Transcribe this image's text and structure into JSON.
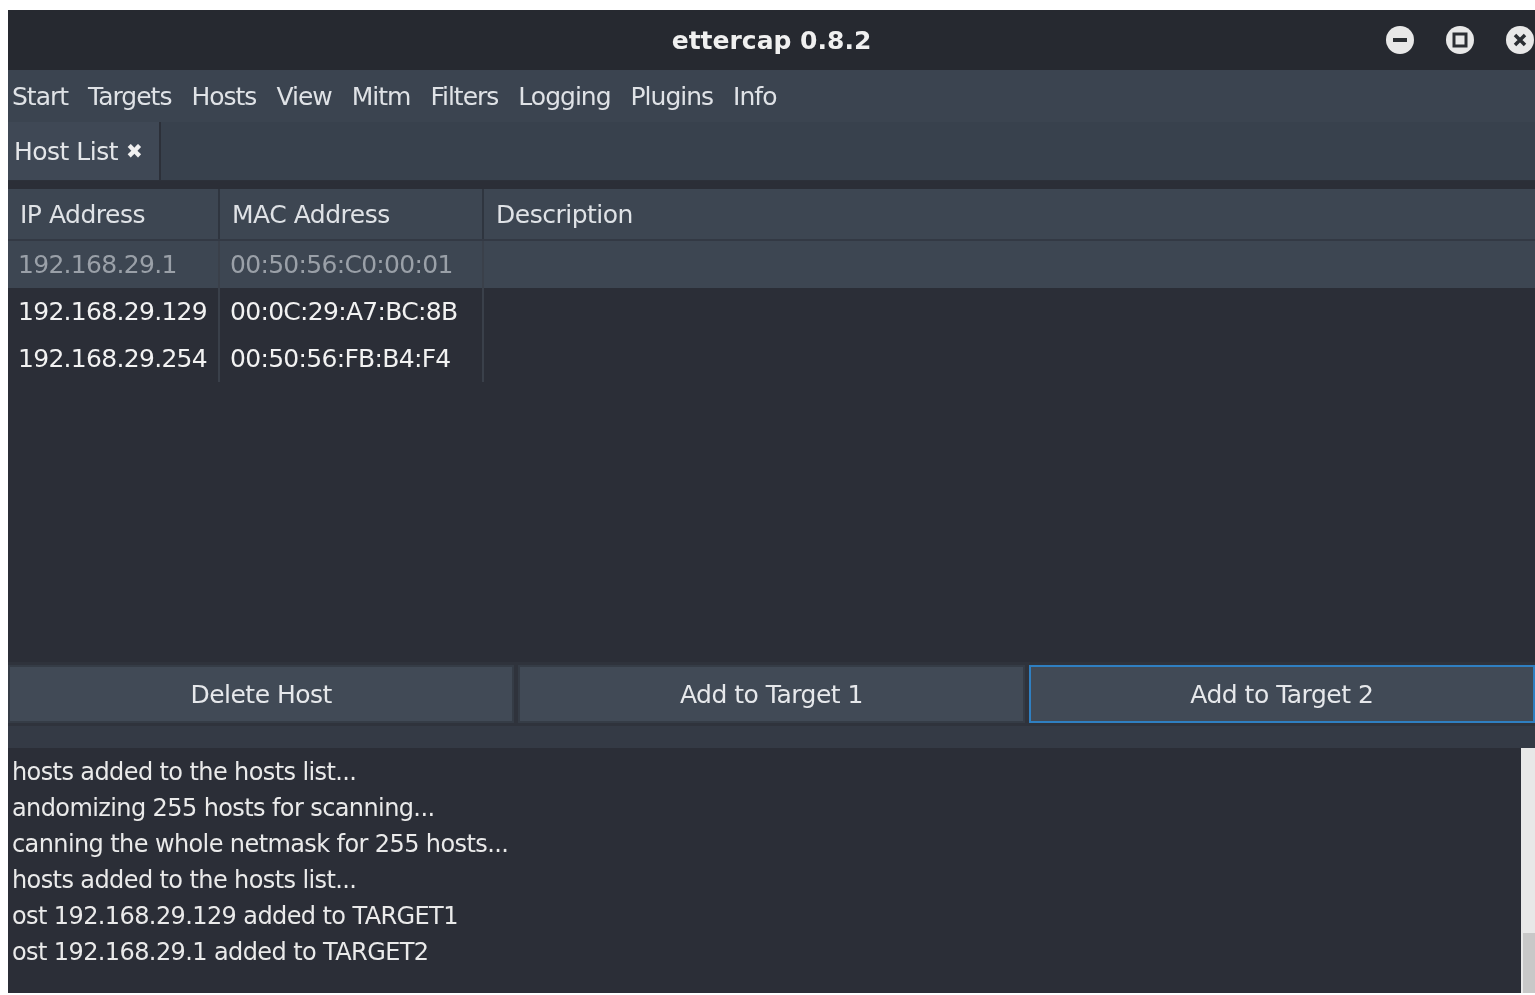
{
  "window": {
    "title": "ettercap 0.8.2"
  },
  "menu": [
    "Start",
    "Targets",
    "Hosts",
    "View",
    "Mitm",
    "Filters",
    "Logging",
    "Plugins",
    "Info"
  ],
  "tabs": [
    {
      "label": "Host List",
      "close": "✖",
      "selected": true
    }
  ],
  "table": {
    "columns": [
      "IP Address",
      "MAC Address",
      "Description"
    ],
    "rows": [
      {
        "ip": "192.168.29.1",
        "mac": "00:50:56:C0:00:01",
        "selected": true
      },
      {
        "ip": "192.168.29.129",
        "mac": "00:0C:29:A7:BC:8B",
        "selected": false
      },
      {
        "ip": "192.168.29.254",
        "mac": "00:50:56:FB:B4:F4",
        "selected": false
      }
    ]
  },
  "buttons": [
    {
      "label": "Delete Host",
      "focused": false
    },
    {
      "label": "Add to Target 1",
      "focused": false
    },
    {
      "label": "Add to Target 2",
      "focused": true
    }
  ],
  "log": [
    "hosts added to the hosts list...",
    "andomizing 255 hosts for scanning...",
    "canning the whole netmask for 255 hosts...",
    "hosts added to the hosts list...",
    "ost 192.168.29.129 added to TARGET1",
    "ost 192.168.29.1 added to TARGET2"
  ]
}
